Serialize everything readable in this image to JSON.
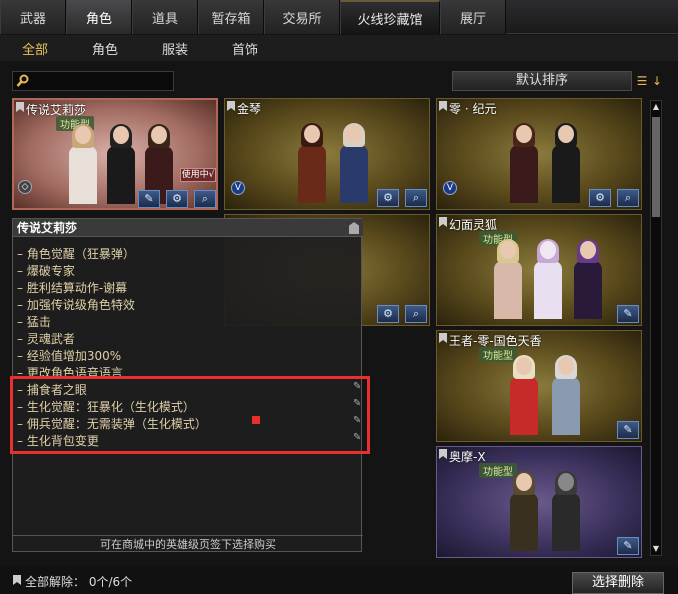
{
  "tabs": [
    "武器",
    "角色",
    "道具",
    "暂存箱",
    "交易所",
    "火线珍藏馆",
    "展厅"
  ],
  "subtabs": [
    "全部",
    "角色",
    "服装",
    "首饰"
  ],
  "search": {
    "placeholder": ""
  },
  "sort": {
    "label": "默认排序"
  },
  "cards": [
    {
      "title": "传说艾莉莎",
      "badge": "功能型",
      "status": "使用中√"
    },
    {
      "title": "金琴",
      "badge": ""
    },
    {
      "title": "零 · 纪元",
      "badge": ""
    },
    {
      "title": "幻面灵狐",
      "badge": "功能型"
    },
    {
      "title": "王者-零-国色天香",
      "badge": "功能型"
    },
    {
      "title": "奥摩-X",
      "badge": "功能型"
    }
  ],
  "tooltip": {
    "title": "传说艾莉莎",
    "items": [
      "角色觉醒（狂暴弹）",
      "爆破专家",
      "胜利结算动作-谢幕",
      "加强传说级角色特效",
      "猛击",
      "灵魂武者",
      "经验值增加300%",
      "更改角色语音语言",
      "捕食者之眼",
      "生化觉醒：狂暴化（生化模式）",
      "佣兵觉醒：无需装弹（生化模式）",
      "生化背包变更"
    ],
    "footer": "可在商城中的英雄级页签下选择购买"
  },
  "footer": {
    "release": "全部解除：  0个/6个",
    "delete_button": "选择删除"
  },
  "colors": {
    "accent": "#e8c35a",
    "highlight": "#e8312f"
  }
}
